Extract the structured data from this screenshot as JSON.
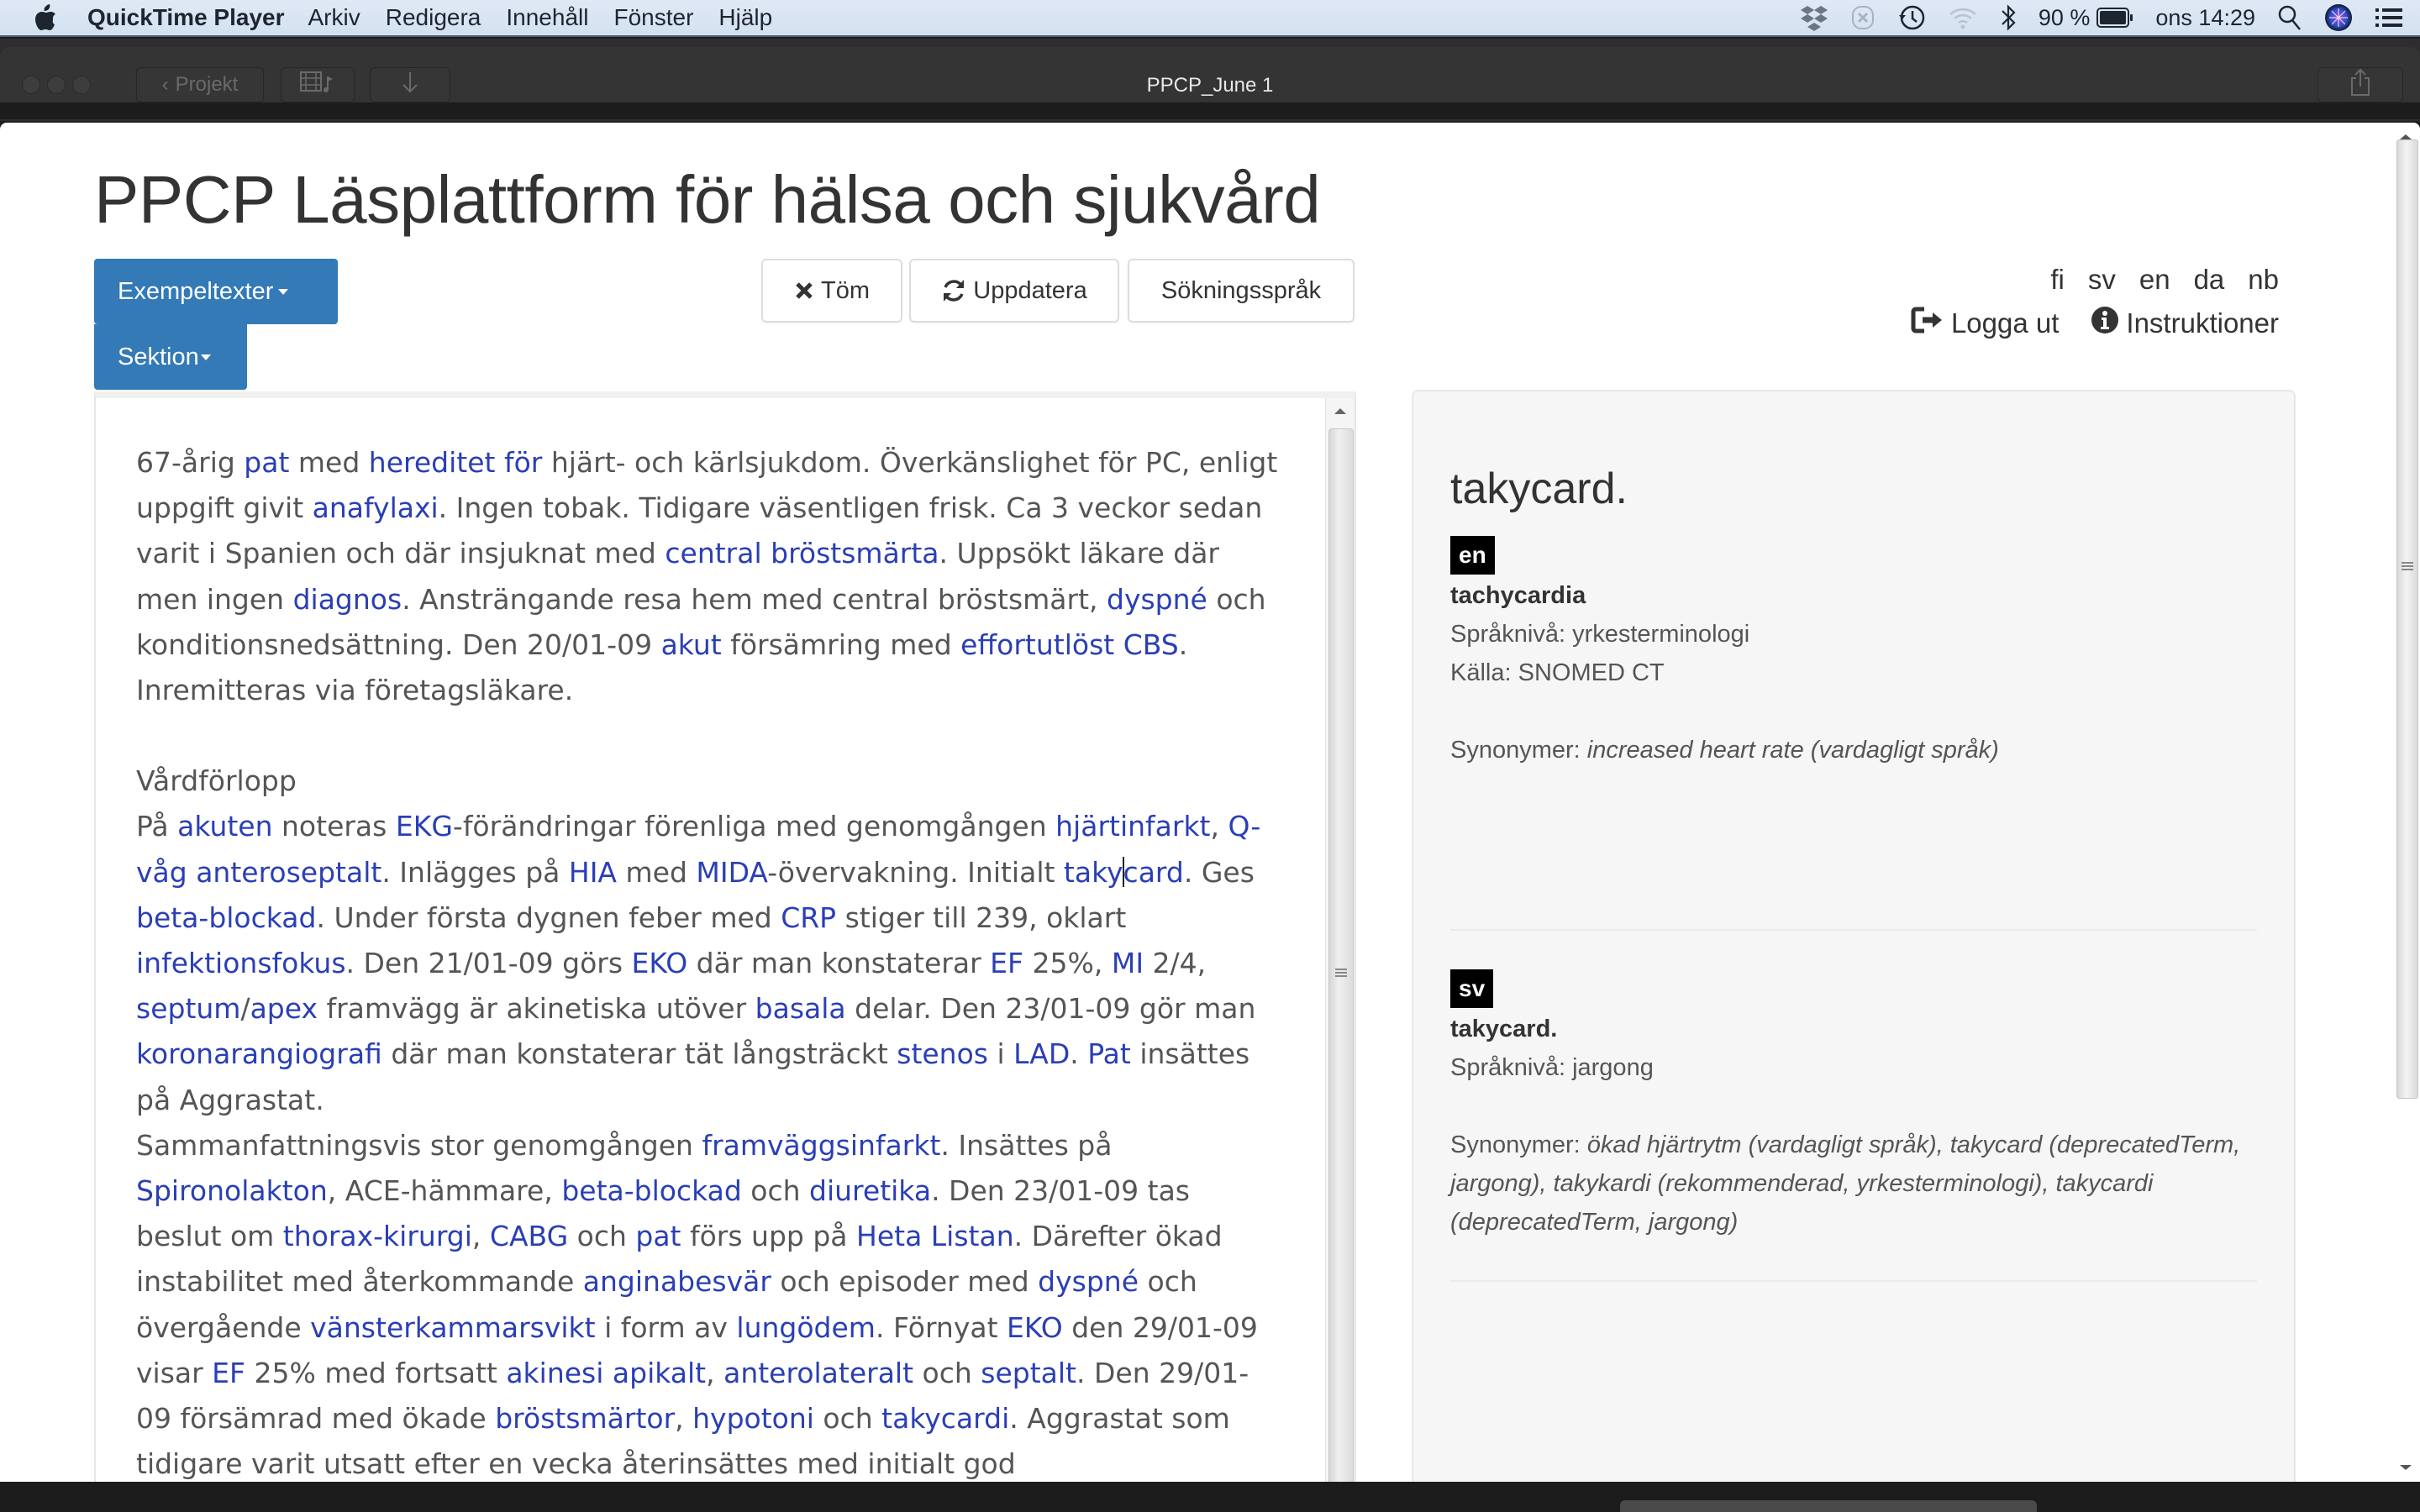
{
  "menubar": {
    "app_name": "QuickTime Player",
    "items": [
      "Arkiv",
      "Redigera",
      "Innehåll",
      "Fönster",
      "Hjälp"
    ],
    "status": {
      "icons": [
        "dropbox-icon",
        "close-circle-icon",
        "time-machine-icon",
        "wifi-icon",
        "bluetooth-icon"
      ],
      "battery_percent": "90 %",
      "clock": "ons 14:29"
    }
  },
  "window": {
    "title": "PPCP_June 1",
    "back_button": "Projekt"
  },
  "page": {
    "title": "PPCP Läsplattform för hälsa och sjukvård",
    "buttons": {
      "examples": "Exempeltexter",
      "section": "Sektion",
      "clear": "Töm",
      "refresh": "Uppdatera",
      "search_lang": "Sökningsspråk"
    },
    "languages": [
      "fi",
      "sv",
      "en",
      "da",
      "nb"
    ],
    "logout": "Logga ut",
    "instructions": "Instruktioner",
    "colors": {
      "primary": "#337ab7",
      "term_link": "#2a3fb5"
    }
  },
  "document": {
    "paragraphs": [
      [
        {
          "t": "67-årig "
        },
        {
          "t": "pat",
          "term": true
        },
        {
          "t": " med "
        },
        {
          "t": "hereditet för",
          "term": true
        },
        {
          "t": " hjärt- och kärlsjukdom. Överkänslighet för PC, enligt uppgift givit "
        },
        {
          "t": "anafylaxi",
          "term": true
        },
        {
          "t": ". Ingen tobak. Tidigare väsentligen frisk. Ca 3 veckor sedan varit i Spanien och där insjuknat med "
        },
        {
          "t": "central bröstsmärta",
          "term": true
        },
        {
          "t": ". Uppsökt läkare där men ingen "
        },
        {
          "t": "diagnos",
          "term": true
        },
        {
          "t": ". Ansträngande resa hem med central bröstsmärt, "
        },
        {
          "t": "dyspné",
          "term": true
        },
        {
          "t": " och konditionsnedsättning. Den 20/01-09 "
        },
        {
          "t": "akut",
          "term": true
        },
        {
          "t": " försämring med "
        },
        {
          "t": "effortutlöst CBS",
          "term": true
        },
        {
          "t": ". Inremitteras via företagsläkare."
        }
      ],
      null,
      [
        {
          "t": "Vårdförlopp"
        }
      ],
      [
        {
          "t": "På "
        },
        {
          "t": "akuten",
          "term": true
        },
        {
          "t": " noteras "
        },
        {
          "t": "EKG",
          "term": true
        },
        {
          "t": "-förändringar förenliga med genomgången "
        },
        {
          "t": "hjärtinfarkt",
          "term": true
        },
        {
          "t": ", "
        },
        {
          "t": "Q-våg anteroseptalt",
          "term": true
        },
        {
          "t": ". Inlägges på "
        },
        {
          "t": "HIA",
          "term": true
        },
        {
          "t": " med "
        },
        {
          "t": "MIDA",
          "term": true
        },
        {
          "t": "-övervakning. Initialt "
        },
        {
          "t": "taky",
          "term": true,
          "cursor_after": true
        },
        {
          "t": "card",
          "term": true
        },
        {
          "t": ". Ges "
        },
        {
          "t": "beta-blockad",
          "term": true
        },
        {
          "t": ". Under första dygnen feber med "
        },
        {
          "t": "CRP",
          "term": true
        },
        {
          "t": " stiger till 239, oklart "
        },
        {
          "t": "infektionsfokus",
          "term": true
        },
        {
          "t": ". Den 21/01-09 görs "
        },
        {
          "t": "EKO",
          "term": true
        },
        {
          "t": " där man konstaterar "
        },
        {
          "t": "EF",
          "term": true
        },
        {
          "t": " 25%, "
        },
        {
          "t": "MI",
          "term": true
        },
        {
          "t": " 2/4, "
        },
        {
          "t": "septum",
          "term": true
        },
        {
          "t": "/"
        },
        {
          "t": "apex",
          "term": true
        },
        {
          "t": " framvägg är akinetiska utöver "
        },
        {
          "t": "basala",
          "term": true
        },
        {
          "t": " delar. Den 23/01-09 gör man "
        },
        {
          "t": "koronarangiografi",
          "term": true
        },
        {
          "t": " där man konstaterar tät långsträckt "
        },
        {
          "t": "stenos",
          "term": true
        },
        {
          "t": " i "
        },
        {
          "t": "LAD",
          "term": true
        },
        {
          "t": ". "
        },
        {
          "t": "Pat",
          "term": true
        },
        {
          "t": " insättes på Aggrastat."
        }
      ],
      [
        {
          "t": "Sammanfattningsvis stor genomgången "
        },
        {
          "t": "framväggsinfarkt",
          "term": true
        },
        {
          "t": ". Insättes på "
        },
        {
          "t": "Spironolakton",
          "term": true
        },
        {
          "t": ", ACE-hämmare, "
        },
        {
          "t": "beta-blockad",
          "term": true
        },
        {
          "t": " och "
        },
        {
          "t": "diuretika",
          "term": true
        },
        {
          "t": ". Den 23/01-09 tas beslut om "
        },
        {
          "t": "thorax-kirurgi",
          "term": true
        },
        {
          "t": ", "
        },
        {
          "t": "CABG",
          "term": true
        },
        {
          "t": " och "
        },
        {
          "t": "pat",
          "term": true
        },
        {
          "t": " förs upp på "
        },
        {
          "t": "Heta Listan",
          "term": true
        },
        {
          "t": ". Därefter ökad instabilitet med återkommande "
        },
        {
          "t": "anginabesvär",
          "term": true
        },
        {
          "t": " och episoder med "
        },
        {
          "t": "dyspné",
          "term": true
        },
        {
          "t": " och övergående "
        },
        {
          "t": "vänsterkammarsvikt",
          "term": true
        },
        {
          "t": " i form av "
        },
        {
          "t": "lungödem",
          "term": true
        },
        {
          "t": ". Förnyat "
        },
        {
          "t": "EKO",
          "term": true
        },
        {
          "t": " den 29/01-09 visar "
        },
        {
          "t": "EF",
          "term": true
        },
        {
          "t": " 25% med fortsatt "
        },
        {
          "t": "akinesi apikalt",
          "term": true
        },
        {
          "t": ", "
        },
        {
          "t": "anterolateralt",
          "term": true
        },
        {
          "t": " och "
        },
        {
          "t": "septalt",
          "term": true
        },
        {
          "t": ". Den 29/01-09 försämrad med ökade "
        },
        {
          "t": "bröstsmärtor",
          "term": true
        },
        {
          "t": ", "
        },
        {
          "t": "hypotoni",
          "term": true
        },
        {
          "t": " och "
        },
        {
          "t": "takycardi",
          "term": true
        },
        {
          "t": ". Aggrastat som tidigare varit utsatt efter en vecka återinsättes med initialt god"
        }
      ]
    ]
  },
  "info_panel": {
    "heading": "takycard.",
    "entries": [
      {
        "lang": "en",
        "term": "tachycardia",
        "level_label": "Språknivå:",
        "level": "yrkesterminologi",
        "source_label": "Källa:",
        "source": "SNOMED CT",
        "synonyms_label": "Synonymer:",
        "synonyms": "increased heart rate (vardagligt språk)"
      },
      {
        "lang": "sv",
        "term": "takycard.",
        "level_label": "Språknivå:",
        "level": "jargong",
        "synonyms_label": "Synonymer:",
        "synonyms": "ökad hjärtrytm (vardagligt språk), takycard (deprecatedTerm, jargong), takykardi (rekommenderad, yrkesterminologi), takycardi (deprecatedTerm, jargong)"
      }
    ]
  }
}
